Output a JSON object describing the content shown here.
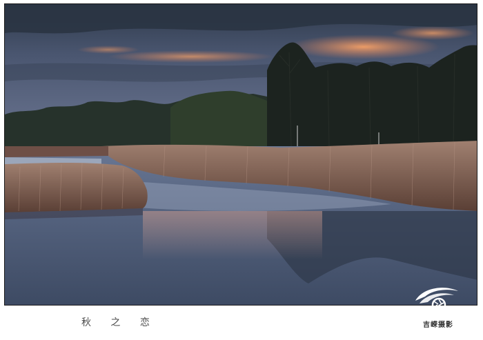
{
  "photo": {
    "description_alt": "",
    "colors": {
      "sky_top": "#3a4658",
      "sky_mid": "#55607a",
      "sunset_glow": "#e98a55",
      "tree_line": "#1f2a22",
      "reeds": "#8a6a58",
      "water": "#4b5a74"
    }
  },
  "caption": {
    "text": "秋 之 恋"
  },
  "signature": {
    "text": "吉嵘摄影"
  },
  "logo": {
    "icon": "aperture-swirl-icon",
    "color": "#ffffff"
  }
}
